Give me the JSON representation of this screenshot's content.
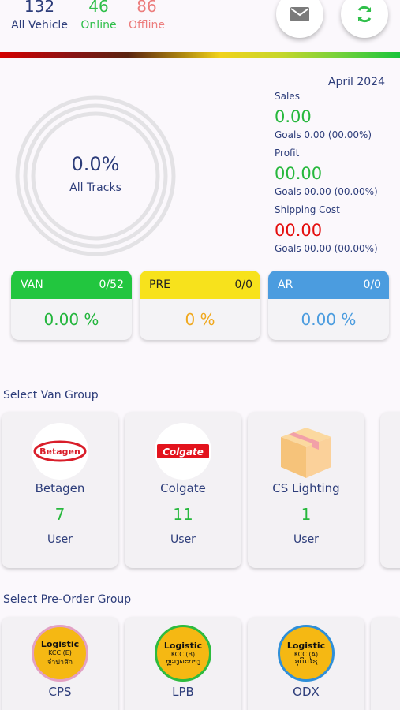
{
  "stats": {
    "all": {
      "value": "132",
      "label": "All Vehicle"
    },
    "online": {
      "value": "46",
      "label": "Online"
    },
    "offline": {
      "value": "86",
      "label": "Offline"
    }
  },
  "icons": {
    "mail": "mail-icon",
    "refresh": "refresh-icon"
  },
  "overview": {
    "percent": "0.0%",
    "percent_label": "All Tracks",
    "month": "April 2024"
  },
  "metrics": {
    "sales": {
      "title": "Sales",
      "value": "0.00",
      "goal": "Goals 0.00 (00.00%)"
    },
    "profit": {
      "title": "Profit",
      "value": "00.00",
      "goal": "Goals 00.00 (00.00%)"
    },
    "shipping": {
      "title": "Shipping Cost",
      "value": "00.00",
      "goal": "Goals 00.00 (00.00%)"
    }
  },
  "cards": {
    "van": {
      "label": "VAN",
      "count": "0/52",
      "value": "0.00 %"
    },
    "pre": {
      "label": "PRE",
      "count": "0/0",
      "value": "0 %"
    },
    "ar": {
      "label": "AR",
      "count": "0/0",
      "value": "0.00 %"
    }
  },
  "van_group": {
    "title": "Select  Van Group",
    "items": [
      {
        "name": "Betagen",
        "count": "7",
        "user": "User",
        "logo_text": "Betagen"
      },
      {
        "name": "Colgate",
        "count": "11",
        "user": "User",
        "logo_text": "Colgate"
      },
      {
        "name": "CS Lighting",
        "count": "1",
        "user": "User"
      }
    ]
  },
  "pre_group": {
    "title": "Select  Pre-Order Group",
    "items": [
      {
        "name": "CPS",
        "badge_title": "Logistic",
        "badge_sub": "KCC (E)",
        "badge_local": "จำปาสัก"
      },
      {
        "name": "LPB",
        "badge_title": "Logistic",
        "badge_sub": "KCC (B)",
        "badge_local": "ຫຼວງພະບາງ"
      },
      {
        "name": "ODX",
        "badge_title": "Logistic",
        "badge_sub": "KCC (A)",
        "badge_local": "ອຸດົມໄຊ"
      }
    ]
  },
  "colors": {
    "online": "#2fbf4a",
    "offline": "#ec7d7d",
    "van": "#22c63f",
    "pre": "#f7e21c",
    "ar": "#4b9cdf",
    "loss": "#e40f0f"
  }
}
